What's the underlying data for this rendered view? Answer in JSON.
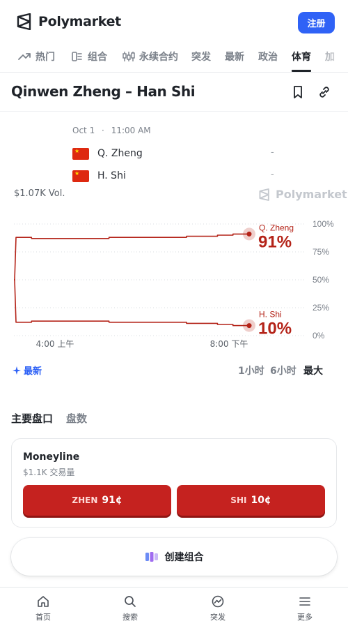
{
  "app": {
    "name": "Polymarket",
    "signup_label": "注册"
  },
  "nav": {
    "items": [
      {
        "label": "热门",
        "icon": "trending-icon"
      },
      {
        "label": "组合",
        "icon": "combo-icon"
      },
      {
        "label": "永续合约",
        "icon": "candlestick-icon"
      },
      {
        "label": "突发"
      },
      {
        "label": "最新"
      },
      {
        "label": "政治"
      },
      {
        "label": "体育",
        "active": true
      },
      {
        "label": "加"
      }
    ]
  },
  "market": {
    "title": "Qinwen Zheng – Han Shi",
    "date": "Oct 1",
    "separator": "·",
    "time": "11:00 AM",
    "teams": [
      {
        "name": "Q. Zheng",
        "score": "-",
        "flag": "china-flag"
      },
      {
        "name": "H. Shi",
        "score": "-",
        "flag": "china-flag"
      }
    ],
    "volume": "$1.07K Vol.",
    "watermark": "Polymarket"
  },
  "chart_data": {
    "type": "line",
    "x_ticks": [
      "4:00 上午",
      "8:00 下午"
    ],
    "y_ticks": [
      "100%",
      "75%",
      "50%",
      "25%",
      "0%"
    ],
    "ylim": [
      0,
      100
    ],
    "grid": true,
    "series": [
      {
        "name": "Q. Zheng",
        "latest": "91%",
        "color": "#b42318",
        "values": [
          50,
          88,
          87,
          87,
          87,
          87,
          87,
          88,
          88,
          88,
          88,
          88,
          89,
          89,
          90,
          91,
          91
        ]
      },
      {
        "name": "H. Shi",
        "latest": "10%",
        "color": "#b42318",
        "values": [
          50,
          12,
          13,
          13,
          13,
          13,
          13,
          12,
          12,
          12,
          12,
          12,
          11,
          11,
          10,
          9,
          9
        ]
      }
    ]
  },
  "time_controls": {
    "latest_label": "最新",
    "ranges": [
      {
        "label": "1小时"
      },
      {
        "label": "6小时"
      },
      {
        "label": "最大",
        "active": true
      }
    ]
  },
  "sections": {
    "tabs": [
      {
        "label": "主要盘口",
        "active": true
      },
      {
        "label": "盘数"
      }
    ]
  },
  "moneyline": {
    "title": "Moneyline",
    "volume": "$1.1K 交易量",
    "options": [
      {
        "name": "ZHEN",
        "price": "91¢",
        "color": "#c5221f"
      },
      {
        "name": "SHI",
        "price": "10¢",
        "color": "#c5221f"
      }
    ]
  },
  "create_combo_label": "创建组合",
  "bottom_nav": {
    "items": [
      {
        "label": "首页",
        "icon": "home-icon"
      },
      {
        "label": "搜索",
        "icon": "search-icon"
      },
      {
        "label": "突发",
        "icon": "breaking-icon"
      },
      {
        "label": "更多",
        "icon": "menu-icon"
      }
    ]
  }
}
